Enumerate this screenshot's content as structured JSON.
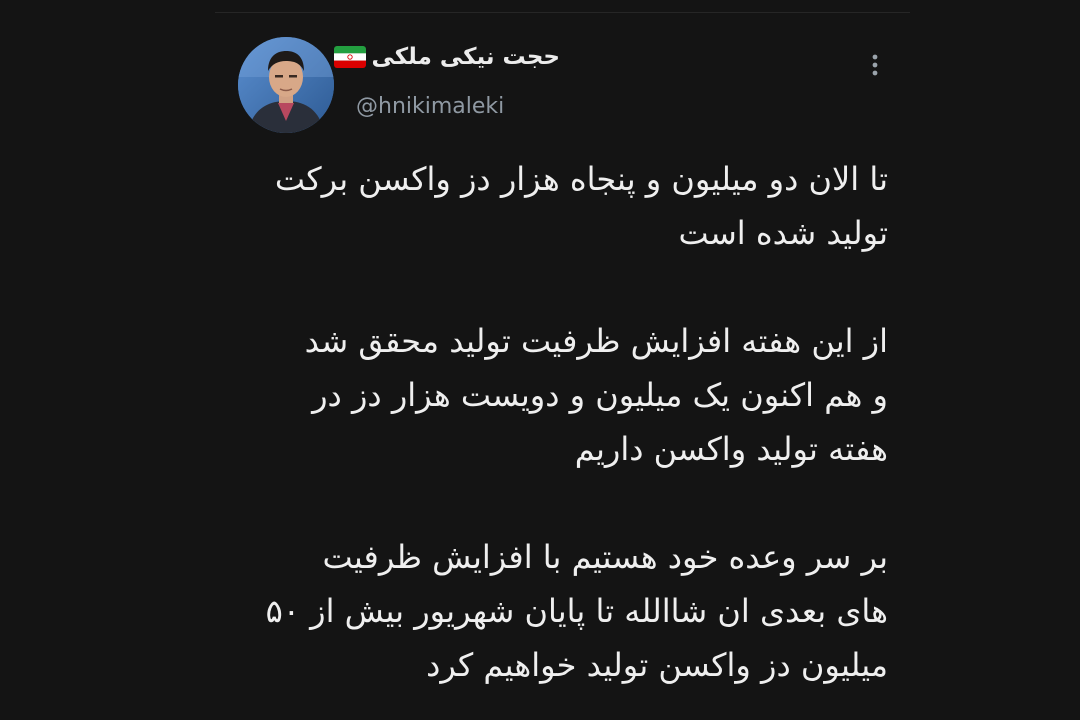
{
  "tweet": {
    "author": {
      "display_name": "حجت نیکی ملکی",
      "handle": "@hnikimaleki",
      "flag": "iran-flag-emoji",
      "avatar": "profile-photo"
    },
    "menu_icon": "more-vertical-icon",
    "paragraphs": [
      {
        "lines": [
          "تا الان دو میلیون و پنجاه هزار دز واکسن برکت",
          "تولید شده است"
        ]
      },
      {
        "lines": [
          "از این هفته افزایش ظرفیت تولید محقق شد",
          "و هم اکنون یک میلیون و دویست هزار دز در",
          "هفته تولید واکسن داریم"
        ]
      },
      {
        "lines": [
          "بر سر وعده خود هستیم با افزایش ظرفیت",
          "های بعدی ان شاالله تا پایان شهریور بیش از ۵۰",
          "میلیون دز واکسن تولید خواهیم کرد"
        ]
      }
    ]
  },
  "colors": {
    "background": "#141414",
    "text": "#efefef",
    "handle": "#8f99a3"
  }
}
